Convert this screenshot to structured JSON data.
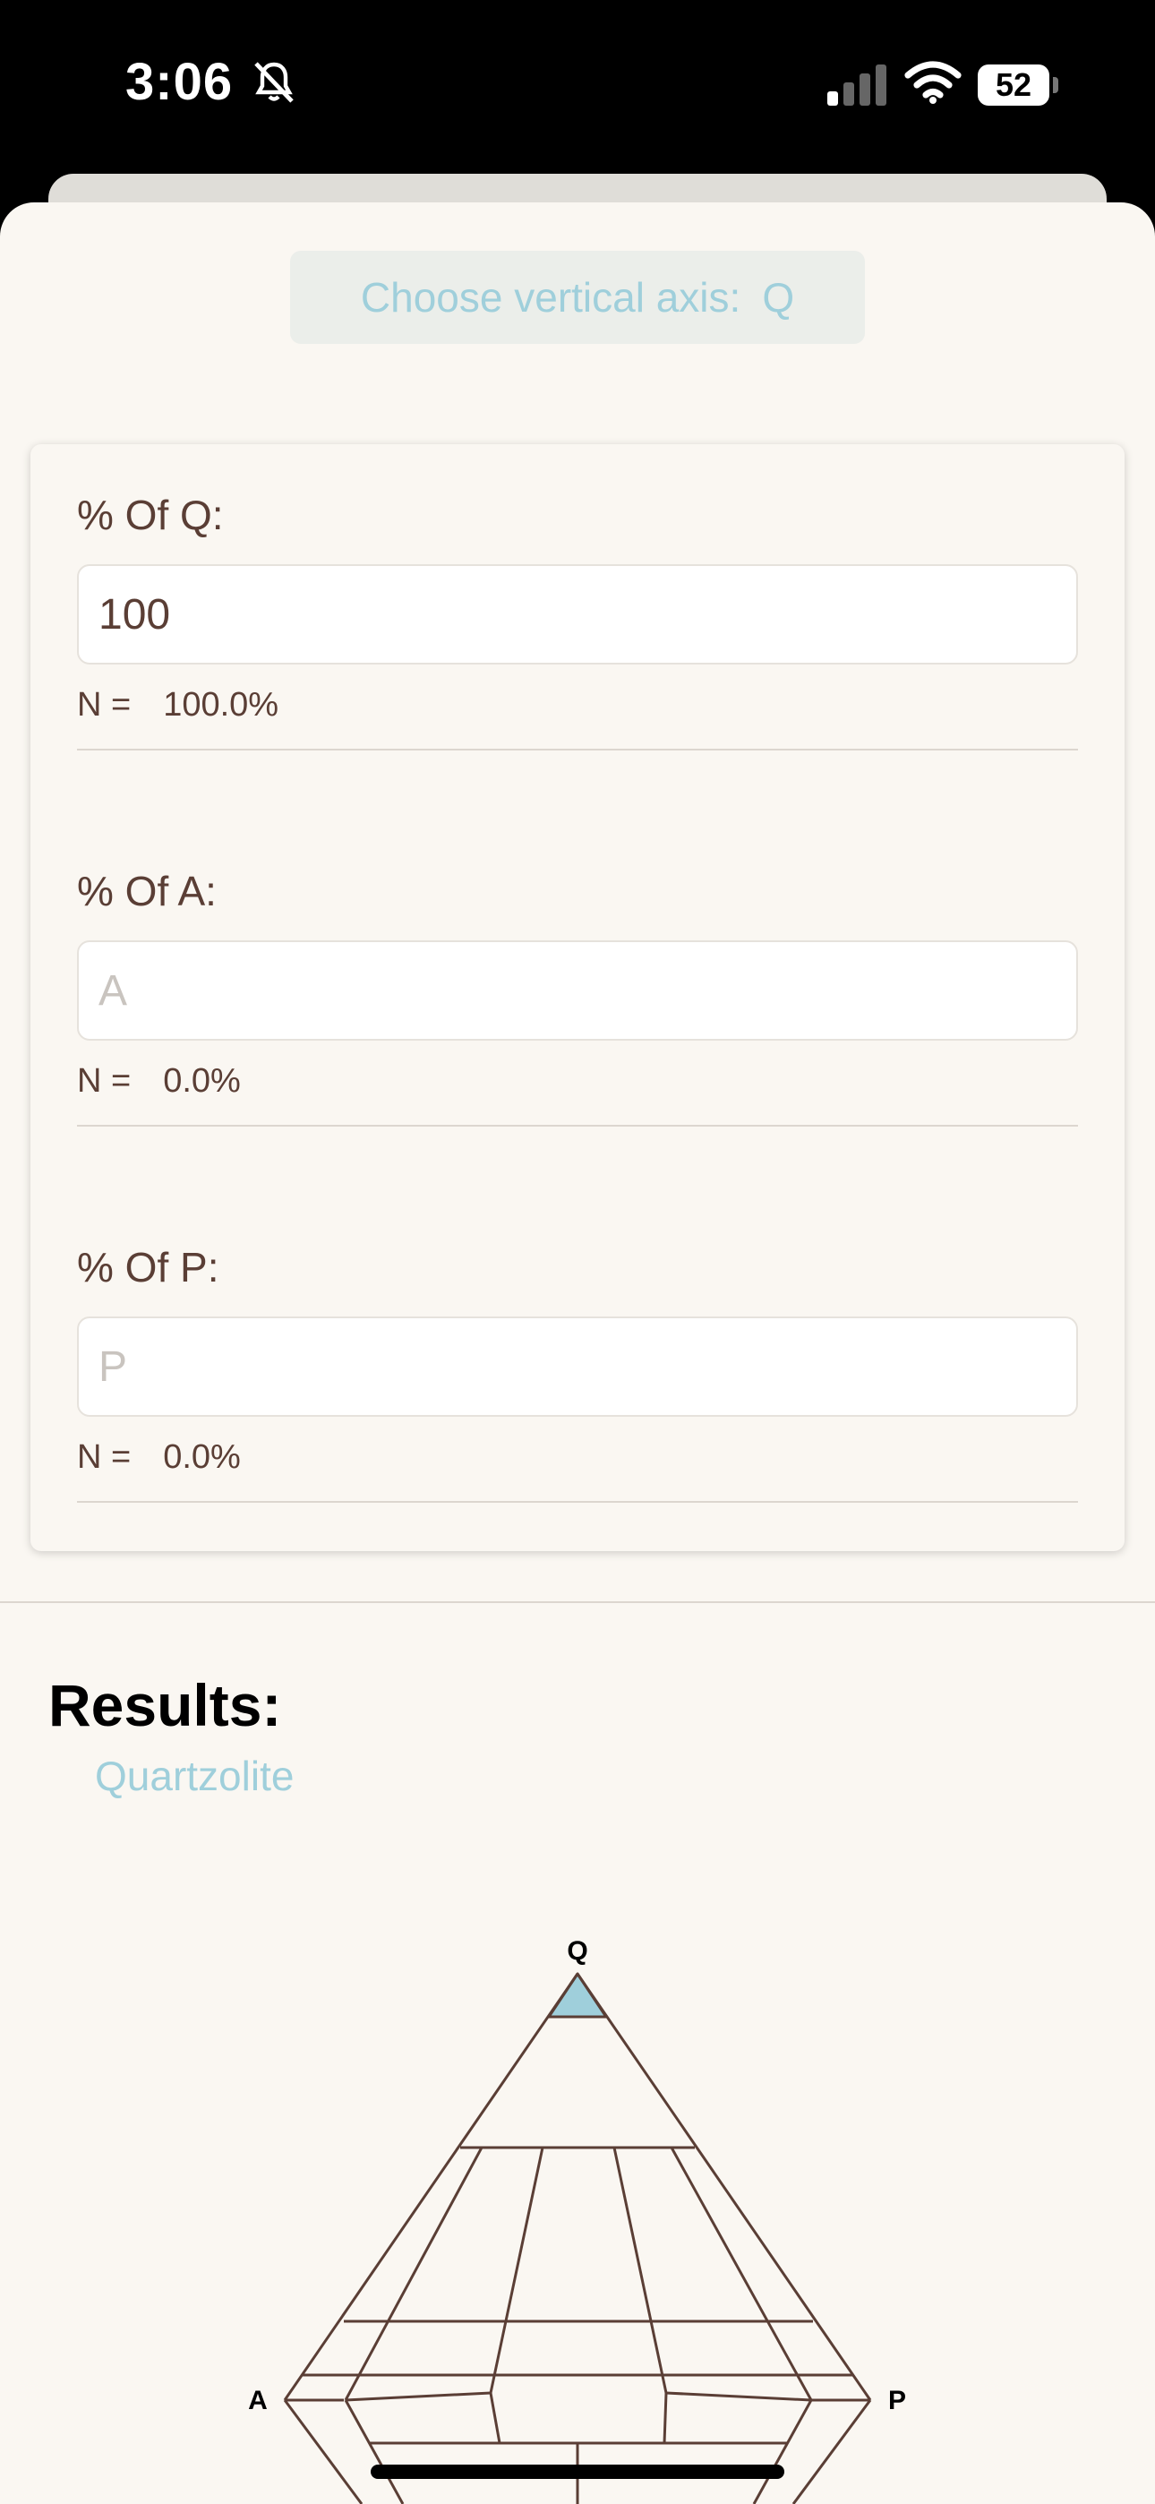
{
  "status_bar": {
    "time": "3:06",
    "battery": "52",
    "icons": [
      "bell-slash-icon",
      "cellular-signal-icon",
      "wifi-icon",
      "battery-icon"
    ]
  },
  "axis_selector": {
    "label": "Choose vertical axis:",
    "value": "Q"
  },
  "fields": [
    {
      "label": "% Of Q:",
      "value": "100",
      "placeholder": "Q",
      "result_label": "N =",
      "result_value": "100.0%"
    },
    {
      "label": "% Of A:",
      "value": "",
      "placeholder": "A",
      "result_label": "N =",
      "result_value": "0.0%"
    },
    {
      "label": "% Of P:",
      "value": "",
      "placeholder": "P",
      "result_label": "N =",
      "result_value": "0.0%"
    }
  ],
  "results": {
    "heading": "Results:",
    "value": "Quartzolite"
  },
  "diagram": {
    "vertex_labels": {
      "top": "Q",
      "left": "A",
      "right": "P"
    },
    "highlight_region": "Quartzolite",
    "colors": {
      "lines": "#5a3e35",
      "highlight": "#9fcfdb"
    }
  },
  "colors": {
    "accent": "#9fcfdb",
    "text": "#5a3e35",
    "background": "#faf7f2"
  }
}
